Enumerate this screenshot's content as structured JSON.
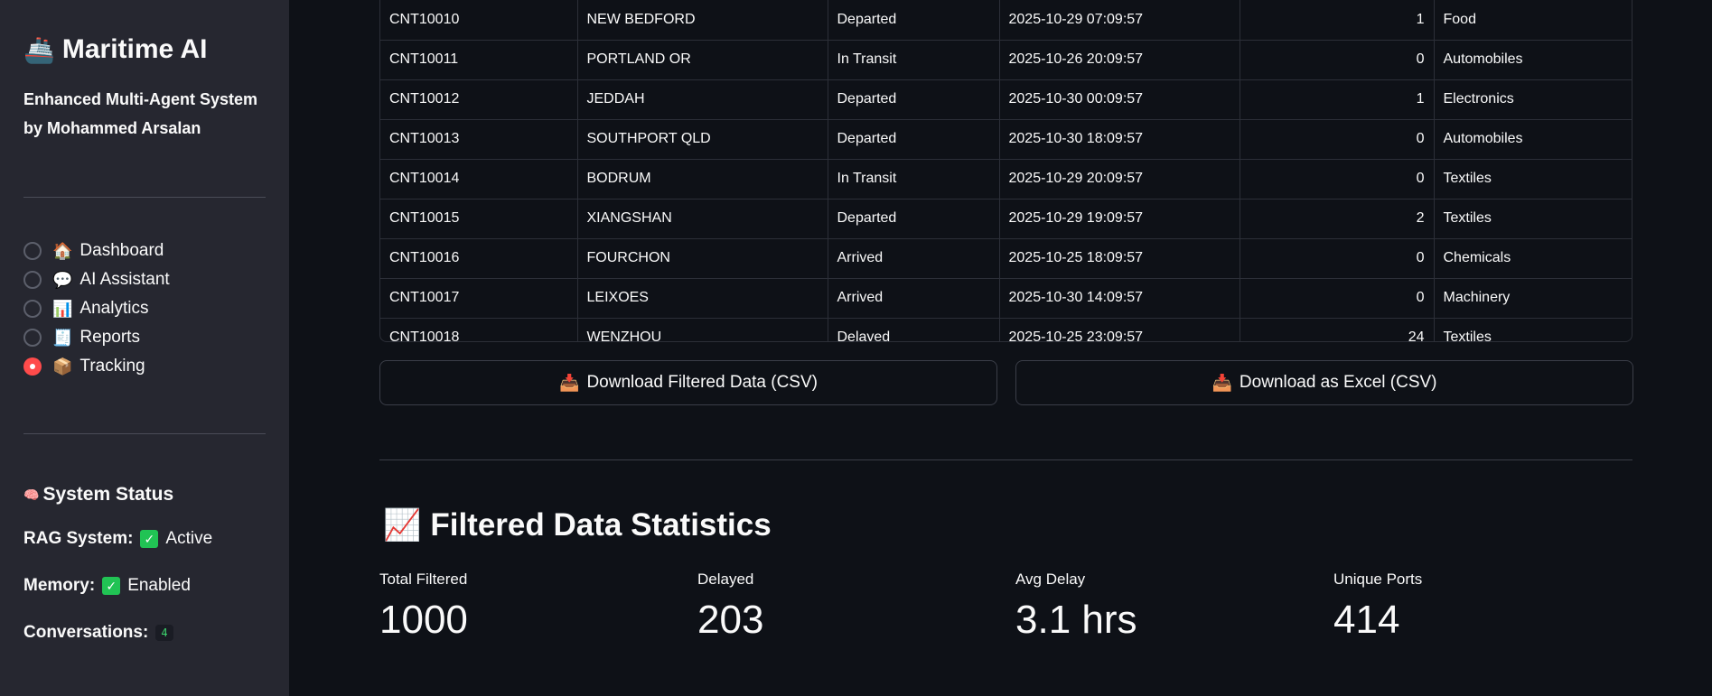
{
  "sidebar": {
    "app_icon": "ship",
    "app_icon_glyph": "🚢",
    "title": "Maritime AI",
    "subtitle": "Enhanced Multi-Agent System by Mohammed Arsalan",
    "nav": [
      {
        "icon": "house",
        "glyph": "🏠",
        "label": "Dashboard",
        "selected": false
      },
      {
        "icon": "speech-bubble",
        "glyph": "💬",
        "label": "AI Assistant",
        "selected": false
      },
      {
        "icon": "bar-chart",
        "glyph": "📊",
        "label": "Analytics",
        "selected": false
      },
      {
        "icon": "receipt",
        "glyph": "🧾",
        "label": "Reports",
        "selected": false
      },
      {
        "icon": "package",
        "glyph": "📦",
        "label": "Tracking",
        "selected": true
      }
    ],
    "status": {
      "title_icon": "brain",
      "title_glyph": "🧠",
      "title": "System Status",
      "rag_label": "RAG System:",
      "rag_value": "Active",
      "memory_label": "Memory:",
      "memory_value": "Enabled",
      "conversations_label": "Conversations:",
      "conversations_value": "4"
    }
  },
  "table": {
    "rows": [
      [
        "CNT10010",
        "NEW BEDFORD",
        "Departed",
        "2025-10-29 07:09:57",
        "1",
        "Food"
      ],
      [
        "CNT10011",
        "PORTLAND OR",
        "In Transit",
        "2025-10-26 20:09:57",
        "0",
        "Automobiles"
      ],
      [
        "CNT10012",
        "JEDDAH",
        "Departed",
        "2025-10-30 00:09:57",
        "1",
        "Electronics"
      ],
      [
        "CNT10013",
        "SOUTHPORT QLD",
        "Departed",
        "2025-10-30 18:09:57",
        "0",
        "Automobiles"
      ],
      [
        "CNT10014",
        "BODRUM",
        "In Transit",
        "2025-10-29 20:09:57",
        "0",
        "Textiles"
      ],
      [
        "CNT10015",
        "XIANGSHAN",
        "Departed",
        "2025-10-29 19:09:57",
        "2",
        "Textiles"
      ],
      [
        "CNT10016",
        "FOURCHON",
        "Arrived",
        "2025-10-25 18:09:57",
        "0",
        "Chemicals"
      ],
      [
        "CNT10017",
        "LEIXOES",
        "Arrived",
        "2025-10-30 14:09:57",
        "0",
        "Machinery"
      ],
      [
        "CNT10018",
        "WENZHOU",
        "Delayed",
        "2025-10-25 23:09:57",
        "24",
        "Textiles"
      ]
    ]
  },
  "buttons": {
    "icon": "inbox-tray",
    "glyph": "📥",
    "download_csv": "Download Filtered Data (CSV)",
    "download_excel": "Download as Excel (CSV)"
  },
  "stats": {
    "icon": "chart-increasing",
    "glyph": "📈",
    "title": "Filtered Data Statistics",
    "metrics": [
      {
        "label": "Total Filtered",
        "value": "1000"
      },
      {
        "label": "Delayed",
        "value": "203"
      },
      {
        "label": "Avg Delay",
        "value": "3.1 hrs"
      },
      {
        "label": "Unique Ports",
        "value": "414"
      }
    ]
  },
  "colors": {
    "background": "#0e1117",
    "sidebar": "#262730",
    "accent_radio": "#ff4b4b",
    "check_green": "#21c354"
  }
}
